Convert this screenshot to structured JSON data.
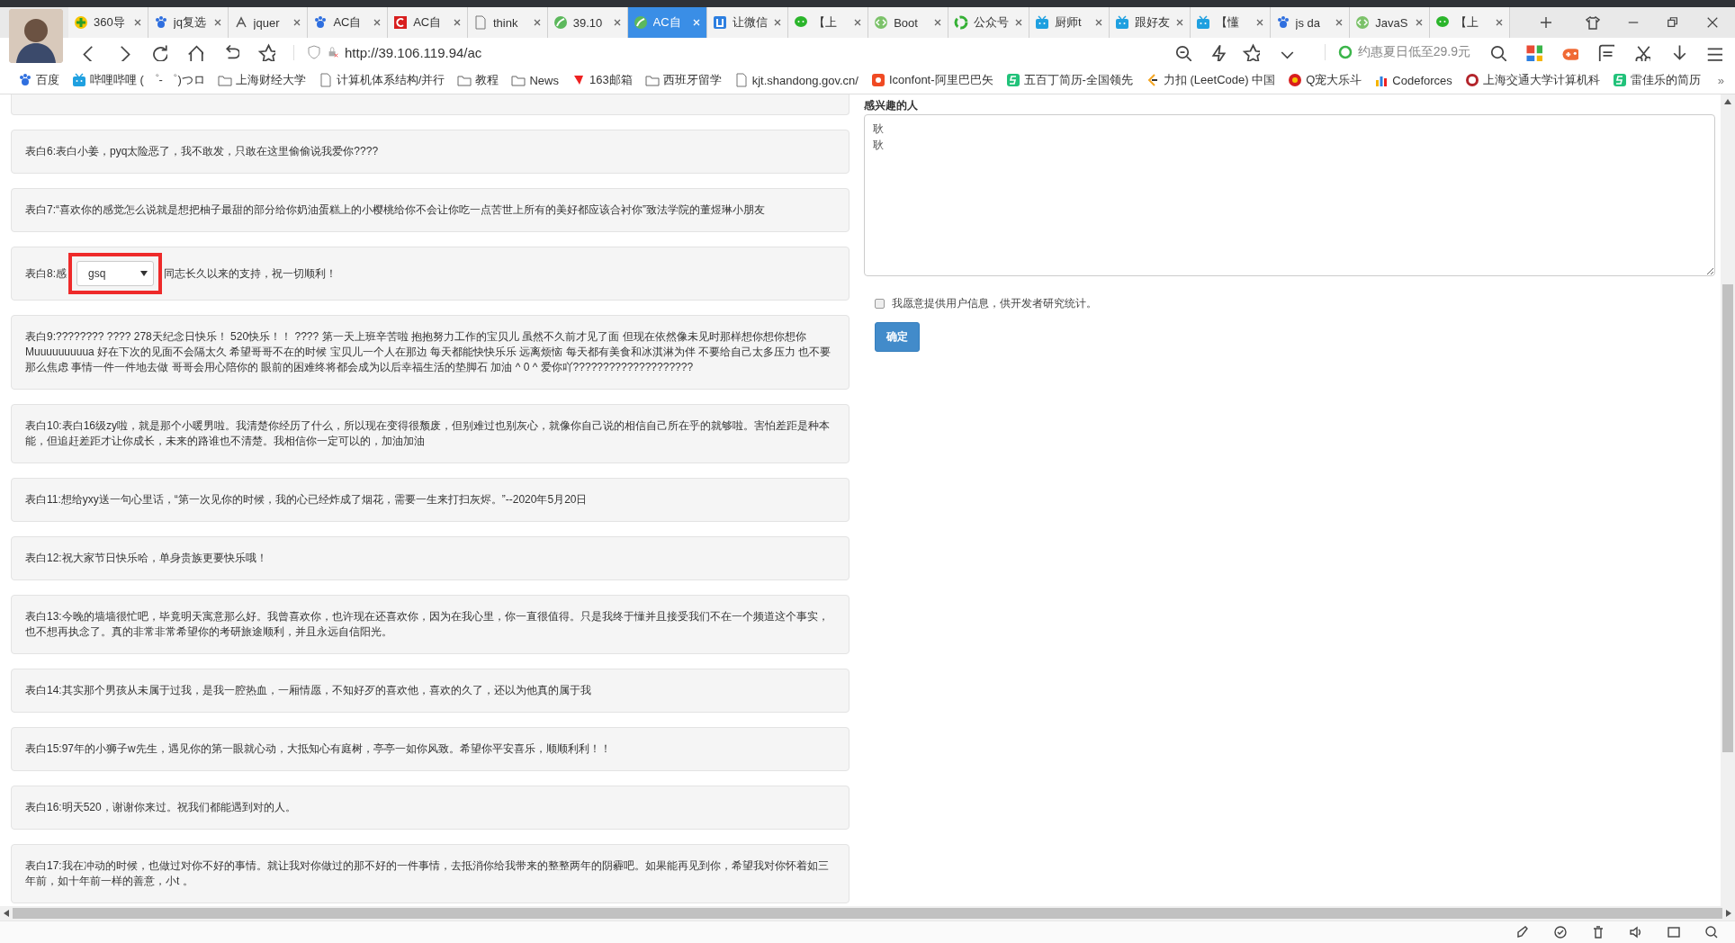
{
  "browser": {
    "tabs": [
      {
        "label": "360导",
        "selected": false
      },
      {
        "label": "jq复选",
        "selected": false
      },
      {
        "label": "jquer",
        "selected": false
      },
      {
        "label": "AC自",
        "selected": false
      },
      {
        "label": "AC自",
        "selected": false
      },
      {
        "label": "think",
        "selected": false
      },
      {
        "label": "39.10",
        "selected": false
      },
      {
        "label": "AC自",
        "selected": true
      },
      {
        "label": "让微信",
        "selected": false
      },
      {
        "label": "【上",
        "selected": false
      },
      {
        "label": "Boot",
        "selected": false
      },
      {
        "label": "公众号",
        "selected": false
      },
      {
        "label": "厨师t",
        "selected": false
      },
      {
        "label": "跟好友",
        "selected": false
      },
      {
        "label": "【懂",
        "selected": false
      },
      {
        "label": "js da",
        "selected": false
      },
      {
        "label": "JavaS",
        "selected": false
      },
      {
        "label": "【上",
        "selected": false
      }
    ],
    "address": "http://39.106.119.94/ac",
    "promo": "约惠夏日低至29.9元",
    "bookmarks": [
      "百度",
      "哔哩哔哩 ( ゜- ゜)つロ",
      "上海财经大学",
      "计算机体系结构/并行",
      "教程",
      "News",
      "163邮箱",
      "西班牙留学",
      "kjt.shandong.gov.cn/",
      "Iconfont-阿里巴巴矢",
      "五百丁简历-全国领先",
      "力扣 (LeetCode) 中国",
      "Q宠大乐斗",
      "Codeforces",
      "上海交通大学计算机科",
      "雷佳乐的简历"
    ],
    "more": "»"
  },
  "posts": [
    {
      "kind": "cut"
    },
    {
      "kind": "text",
      "text": "表白6:表白小姜，pyq太险恶了，我不敢发，只敢在这里偷偷说我爱你????"
    },
    {
      "kind": "text",
      "text": "表白7:“喜欢你的感觉怎么说就是想把柚子最甜的部分给你奶油蛋糕上的小樱桃给你不会让你吃一点苦世上所有的美好都应该合衬你”致法学院的董煜琳小朋友"
    },
    {
      "kind": "select",
      "before": "表白8:感",
      "after": "同志长久以来的支持，祝一切顺利！",
      "value": "gsq",
      "highlighted": true
    },
    {
      "kind": "text",
      "text": "表白9:???????? ???? 278天纪念日快乐！ 520快乐！！ ???? 第一天上班辛苦啦 抱抱努力工作的宝贝儿 虽然不久前才见了面 但现在依然像未见时那样想你想你想你 Muuuuuuuuua 好在下次的见面不会隔太久 希望哥哥不在的时候 宝贝儿一个人在那边 每天都能快快乐乐 远离烦恼 每天都有美食和冰淇淋为伴 不要给自己太多压力 也不要那么焦虑 事情一件一件地去做 哥哥会用心陪你的 眼前的困难终将都会成为以后幸福生活的垫脚石 加油 ^ 0 ^ 爱你吖????????????????????"
    },
    {
      "kind": "text",
      "text": "表白10:表白16级zy啦，就是那个小暖男啦。我清楚你经历了什么，所以现在变得很颓废，但别难过也别灰心，就像你自己说的相信自己所在乎的就够啦。害怕差距是种本能，但追赶差距才让你成长，未来的路谁也不清楚。我相信你一定可以的，加油加油"
    },
    {
      "kind": "text",
      "text": "表白11:想给yxy送一句心里话，“第一次见你的时候，我的心已经炸成了烟花，需要一生来打扫灰烬。”--2020年5月20日"
    },
    {
      "kind": "text",
      "text": "表白12:祝大家节日快乐哈，单身贵族更要快乐哦！"
    },
    {
      "kind": "text",
      "text": "表白13:今晚的墙墙很忙吧，毕竟明天寓意那么好。我曾喜欢你，也许现在还喜欢你，因为在我心里，你一直很值得。只是我终于懂并且接受我们不在一个频道这个事实，也不想再执念了。真的非常非常希望你的考研旅途顺利，并且永远自信阳光。"
    },
    {
      "kind": "text",
      "text": "表白14:其实那个男孩从未属于过我，是我一腔热血，一厢情愿，不知好歹的喜欢他，喜欢的久了，还以为他真的属于我"
    },
    {
      "kind": "text",
      "text": "表白15:97年的小狮子w先生，遇见你的第一眼就心动，大抵知心有庭树，亭亭一如你风致。希望你平安喜乐，顺顺利利！！"
    },
    {
      "kind": "text",
      "text": "表白16:明天520，谢谢你来过。祝我们都能遇到对的人。"
    },
    {
      "kind": "text",
      "text": "表白17:我在冲动的时候，也做过对你不好的事情。就让我对你做过的那不好的一件事情，去抵消你给我带来的整整两年的阴霾吧。如果能再见到你，希望我对你怀着如三年前，如十年前一样的善意，小t 。"
    }
  ],
  "form": {
    "label": "感兴趣的人",
    "value_lines": [
      "耿",
      "耿"
    ],
    "consent": {
      "label": "我愿意提供用户信息，供开发者研究统计。",
      "checked": false
    },
    "submit": "确定"
  }
}
